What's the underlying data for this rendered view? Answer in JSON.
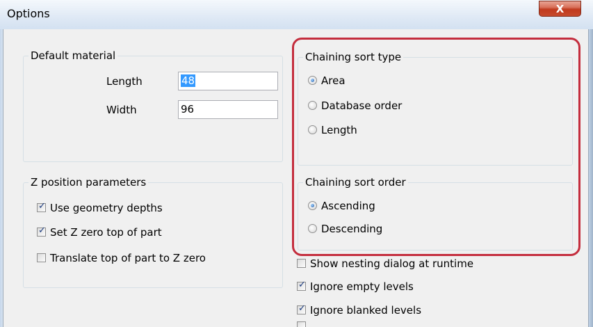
{
  "window": {
    "title": "Options",
    "close_label": "X"
  },
  "default_material": {
    "title": "Default material",
    "length_label": "Length",
    "length_value": "48",
    "width_label": "Width",
    "width_value": "96"
  },
  "z_position": {
    "title": "Z position parameters",
    "items": [
      {
        "label": "Use geometry depths",
        "checked": true
      },
      {
        "label": "Set Z zero top of part",
        "checked": true
      },
      {
        "label": "Translate top of part to Z zero",
        "checked": false
      }
    ]
  },
  "chaining_sort_type": {
    "title": "Chaining sort type",
    "options": [
      {
        "label": "Area",
        "selected": true
      },
      {
        "label": "Database order",
        "selected": false
      },
      {
        "label": "Length",
        "selected": false
      }
    ]
  },
  "chaining_sort_order": {
    "title": "Chaining sort order",
    "options": [
      {
        "label": "Ascending",
        "selected": true
      },
      {
        "label": "Descending",
        "selected": false
      }
    ]
  },
  "misc_options": [
    {
      "label": "Show nesting dialog at runtime",
      "checked": false
    },
    {
      "label": "Ignore empty levels",
      "checked": true
    },
    {
      "label": "Ignore blanked levels",
      "checked": true
    }
  ],
  "colors": {
    "highlight": "#c42d3d",
    "selection": "#3399ff",
    "dialog_bg": "#f0f0f0"
  }
}
